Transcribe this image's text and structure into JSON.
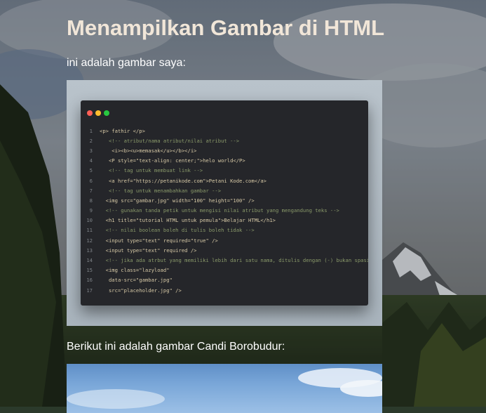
{
  "page": {
    "title": "Menampilkan Gambar di HTML",
    "intro": "ini adalah gambar saya:",
    "borobudur_caption": "Berikut ini adalah gambar Candi Borobudur:"
  },
  "editor": {
    "window_dots": [
      {
        "name": "close",
        "color": "#ff5f57"
      },
      {
        "name": "minimize",
        "color": "#febc2e"
      },
      {
        "name": "maximize",
        "color": "#28c840"
      }
    ],
    "lines": [
      {
        "n": "1",
        "text": "<p> fathir </p>"
      },
      {
        "n": "2",
        "text": "   <!-- atribut/nama atribut/nilai atribut -->"
      },
      {
        "n": "3",
        "text": "    <i><b><u>memasak</u></b></i>"
      },
      {
        "n": "4",
        "text": "   <P style=\"text-align: center;\">helo world</P>"
      },
      {
        "n": "5",
        "text": "   <!-- tag untuk membuat link -->"
      },
      {
        "n": "6",
        "text": "   <a href=\"https://petanikode.com\">Petani Kode.com</a>"
      },
      {
        "n": "7",
        "text": "   <!-- tag untuk menambahkan gambar -->"
      },
      {
        "n": "8",
        "text": "  <img src=\"gambar.jpg\" width=\"100\" height=\"100\" />"
      },
      {
        "n": "9",
        "text": "  <!-- gunakan tanda petik untuk mengisi nilai atribut yang mengandung teks -->"
      },
      {
        "n": "10",
        "text": "  <h1 title=\"tutorial HTML untuk pemula\">Belajar HTML</h1>"
      },
      {
        "n": "11",
        "text": "  <!-- nilai boolean boleh di tulis boleh tidak -->"
      },
      {
        "n": "12",
        "text": "  <input type=\"text\" required=\"true\" />"
      },
      {
        "n": "13",
        "text": "  <input type=\"text\" required />"
      },
      {
        "n": "14",
        "text": "  <!-- jika ada atrbut yang memiliki lebih dari satu nama, ditulis dengan (-) bukan spasi -->"
      },
      {
        "n": "15",
        "text": "  <img class=\"lazyload\""
      },
      {
        "n": "16",
        "text": "   data-src=\"gambar.jpg\""
      },
      {
        "n": "17",
        "text": "   src=\"placeholder.jpg\" />"
      }
    ]
  }
}
